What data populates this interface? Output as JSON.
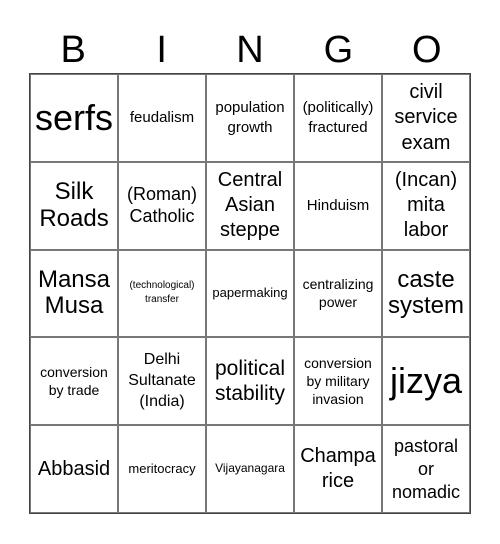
{
  "header": {
    "letters": [
      "B",
      "I",
      "N",
      "G",
      "O"
    ]
  },
  "cells": [
    [
      "serfs",
      "feudalism",
      "population growth",
      "(politically) fractured",
      "civil service exam"
    ],
    [
      "Silk Roads",
      "(Roman) Catholic",
      "Central Asian steppe",
      "Hinduism",
      "(Incan) mita labor"
    ],
    [
      "Mansa Musa",
      "(technological) transfer",
      "papermaking",
      "centralizing power",
      "caste system"
    ],
    [
      "conversion by trade",
      "Delhi Sultanate (India)",
      "political stability",
      "conversion by military invasion",
      "jizya"
    ],
    [
      "Abbasid",
      "meritocracy",
      "Vijayanagara",
      "Champa rice",
      "pastoral or nomadic"
    ]
  ]
}
